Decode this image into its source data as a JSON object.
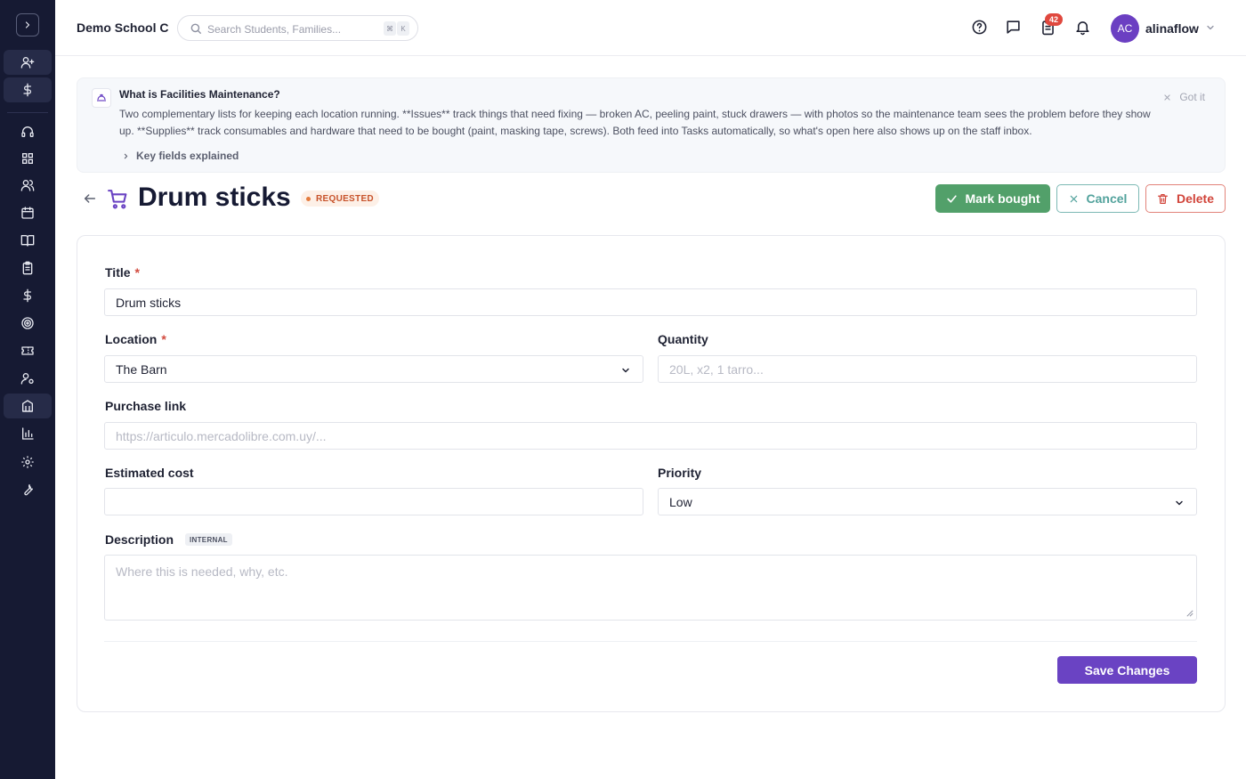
{
  "header": {
    "school_name": "Demo School C",
    "search_placeholder": "Search Students, Families...",
    "search_shortcut_mod": "⌘",
    "search_shortcut_key": "K",
    "tasks_badge": "42",
    "user_initials": "AC",
    "user_name": "alinaflow"
  },
  "info_banner": {
    "title": "What is Facilities Maintenance?",
    "body": "Two complementary lists for keeping each location running. **Issues** track things that need fixing — broken AC, peeling paint, stuck drawers — with photos so the maintenance team sees the problem before they show up. **Supplies** track consumables and hardware that need to be bought (paint, masking tape, screws). Both feed into Tasks automatically, so what's open here also shows up on the staff inbox.",
    "dismiss_label": "Got it",
    "expand_label": "Key fields explained"
  },
  "page": {
    "title": "Drum sticks",
    "status": "REQUESTED",
    "actions": {
      "mark_bought": "Mark bought",
      "cancel": "Cancel",
      "delete": "Delete"
    }
  },
  "form": {
    "title_label": "Title",
    "title_value": "Drum sticks",
    "location_label": "Location",
    "location_value": "The Barn",
    "quantity_label": "Quantity",
    "quantity_placeholder": "20L, x2, 1 tarro...",
    "link_label": "Purchase link",
    "link_placeholder": "https://articulo.mercadolibre.com.uy/...",
    "cost_label": "Estimated cost",
    "cost_value": "",
    "priority_label": "Priority",
    "priority_value": "Low",
    "description_label": "Description",
    "description_tag": "INTERNAL",
    "description_placeholder": "Where this is needed, why, etc.",
    "required_mark": "*",
    "save_label": "Save Changes"
  },
  "icons": {
    "sidebar": [
      "chevron-right-icon",
      "user-plus-icon",
      "dollar-icon",
      "headset-icon",
      "grid-icon",
      "users-icon",
      "calendar-icon",
      "book-icon",
      "clipboard-icon",
      "dollar-icon",
      "target-icon",
      "ticket-icon",
      "user-settings-icon",
      "building-icon",
      "bar-chart-icon",
      "gear-icon",
      "wrench-icon"
    ],
    "topbar": [
      "help-circle-icon",
      "chat-icon",
      "clipboard-list-icon",
      "bell-icon"
    ]
  },
  "colors": {
    "sidebar_bg": "#161a33",
    "accent_purple": "#6a43c3",
    "success_green": "#52a06a",
    "cancel_teal": "#52a29c",
    "danger_red": "#d1443a",
    "status_orange": "#c7522a",
    "badge_red": "#e0483e"
  }
}
